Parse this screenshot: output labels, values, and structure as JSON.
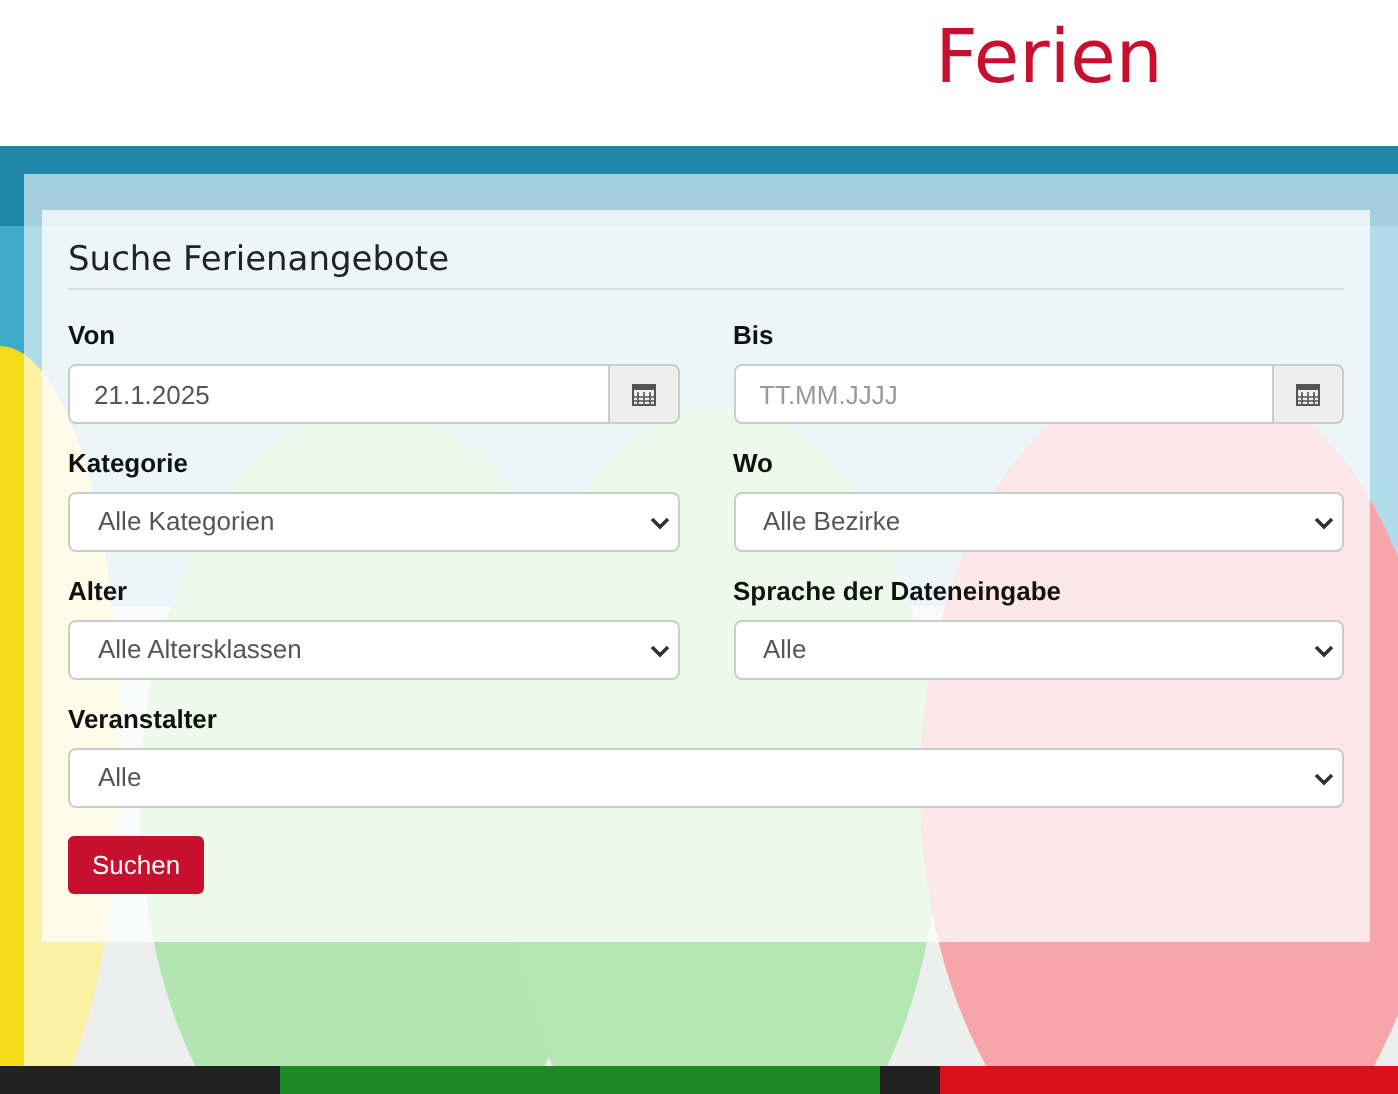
{
  "header": {
    "title": "Ferien"
  },
  "search_form": {
    "title": "Suche Ferienangebote",
    "fields": [
      {
        "kind": "date",
        "label": "Von",
        "value": "21.1.2025"
      },
      {
        "kind": "date",
        "label": "Bis",
        "placeholder": "TT.MM.JJJJ"
      },
      {
        "kind": "select",
        "label": "Kategorie",
        "value": "Alle Kategorien"
      },
      {
        "kind": "select",
        "label": "Wo",
        "value": "Alle Bezirke"
      },
      {
        "kind": "select",
        "label": "Alter",
        "value": "Alle Altersklassen"
      },
      {
        "kind": "select",
        "label": "Sprache der Dateneingabe",
        "value": "Alle"
      },
      {
        "kind": "select",
        "label": "Veranstalter",
        "value": "Alle",
        "wide": true
      }
    ],
    "button": "Suchen"
  }
}
